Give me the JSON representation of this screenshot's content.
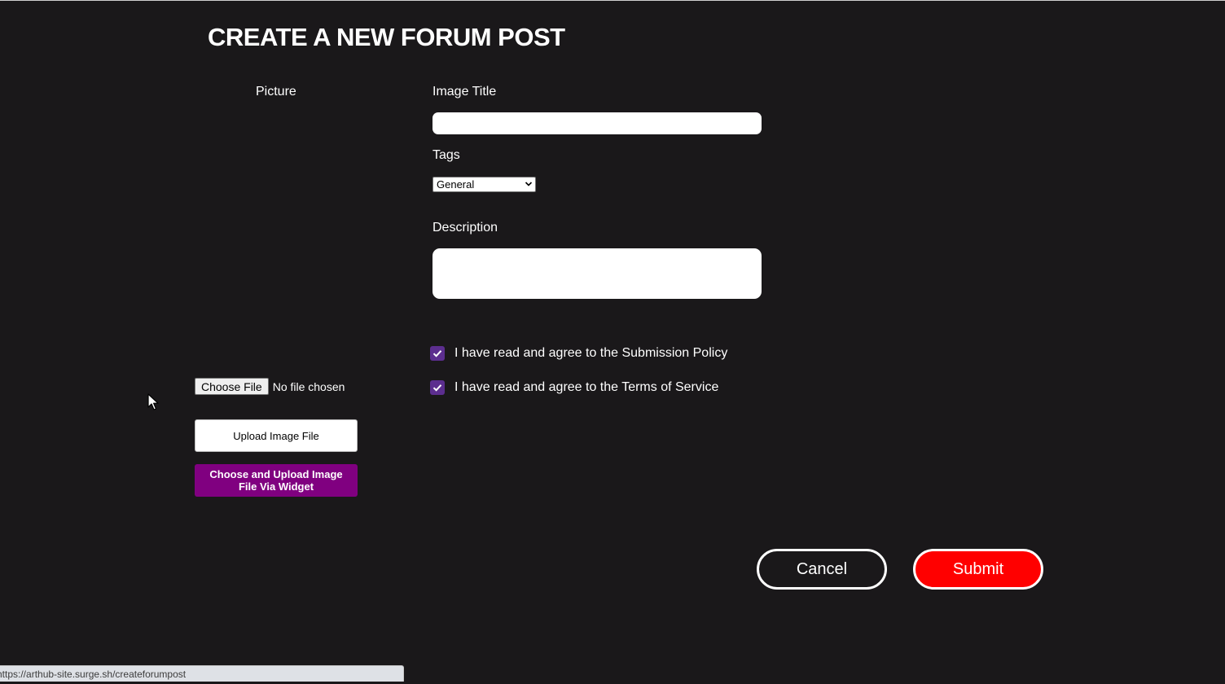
{
  "page": {
    "title": "CREATE A NEW FORUM POST"
  },
  "picture": {
    "label": "Picture",
    "choose_file_label": "Choose File",
    "file_status": "No file chosen",
    "upload_button": "Upload Image File",
    "widget_button": "Choose and Upload Image File Via Widget"
  },
  "form": {
    "image_title_label": "Image Title",
    "image_title_value": "",
    "tags_label": "Tags",
    "tags_selected": "General",
    "description_label": "Description",
    "description_value": "",
    "agreements": [
      {
        "label": "I have read and agree to the Submission Policy",
        "checked": true
      },
      {
        "label": "I have read and agree to the Terms of Service",
        "checked": true
      }
    ]
  },
  "actions": {
    "cancel": "Cancel",
    "submit": "Submit"
  },
  "status_bar": {
    "url": "https://arthub-site.surge.sh/createforumpost"
  },
  "colors": {
    "background": "#1a181a",
    "submit": "#ff0000",
    "widget_button": "#800080",
    "checkbox": "#5c2e8f"
  }
}
